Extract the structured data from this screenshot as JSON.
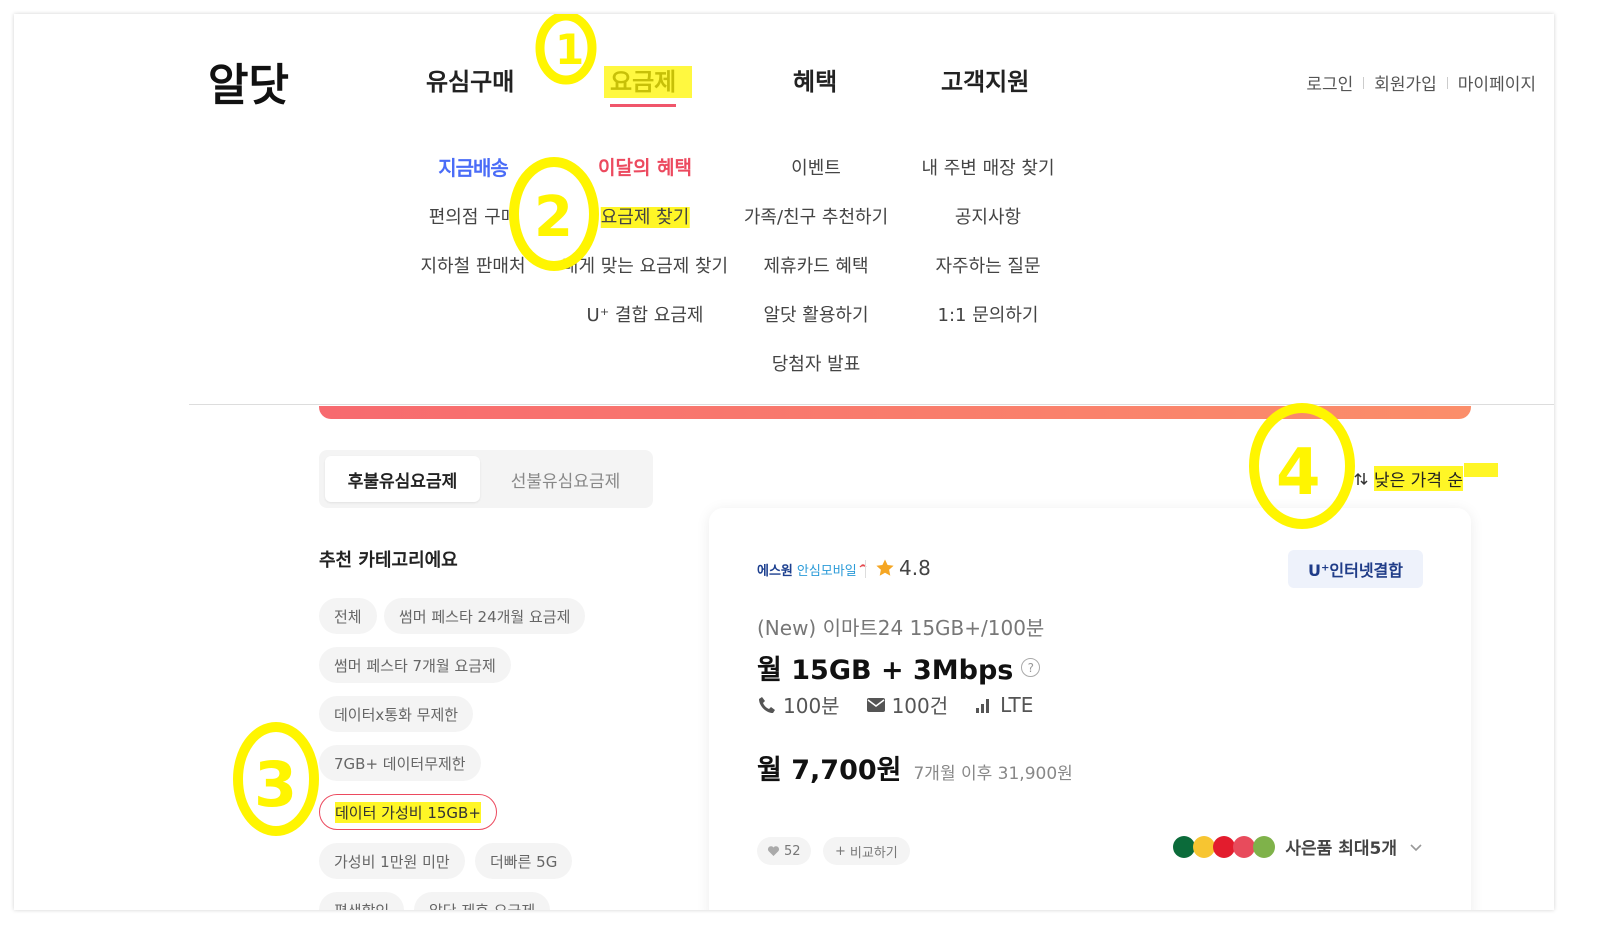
{
  "header": {
    "logo_text": "알닷",
    "nav": [
      "유심구매",
      "요금제",
      "혜택",
      "고객지원"
    ],
    "util": [
      "로그인",
      "회원가입",
      "마이페이지"
    ]
  },
  "submenu": {
    "col1": [
      "지금배송",
      "편의점 구매",
      "지하철 판매처"
    ],
    "col2": [
      "이달의 혜택",
      "요금제 찾기",
      "내게 맞는 요금제 찾기",
      "U⁺ 결합 요금제"
    ],
    "col3": [
      "이벤트",
      "가족/친구 추천하기",
      "제휴카드 혜택",
      "알닷 활용하기",
      "당첨자 발표"
    ],
    "col4": [
      "내 주변 매장 찾기",
      "공지사항",
      "자주하는 질문",
      "1:1 문의하기"
    ]
  },
  "tabs": {
    "active": "후불유심요금제",
    "inactive": "선불유심요금제"
  },
  "category": {
    "title": "추천 카테고리에요",
    "chips": [
      "전체",
      "썸머 페스타 24개월 요금제",
      "썸머 페스타 7개월 요금제",
      "데이터x통화 무제한",
      "7GB+ 데이터무제한",
      "데이터 가성비 15GB+",
      "가성비 1만원 미만",
      "더빠른 5G",
      "평생할인",
      "알닷 제휴 요금제"
    ]
  },
  "sort": {
    "label": "낮은 가격 순",
    "icon": "sort-arrows-icon"
  },
  "card": {
    "carrier_name": "에스원",
    "carrier_sub": "안심모바일",
    "rating": "4.8",
    "badge": "U⁺인터넷결합",
    "plan_name": "(New) 이마트24 15GB+/100분",
    "plan_data": "월 15GB + 3Mbps",
    "specs": {
      "call": "100분",
      "sms": "100건",
      "network": "LTE"
    },
    "price": "월 7,700원",
    "price_after": "7개월 이후 31,900원",
    "likes": "52",
    "compare": "비교하기",
    "gifts": "사은품 최대5개"
  },
  "annotations": [
    "1",
    "2",
    "3",
    "4"
  ],
  "colors": {
    "accent": "#ec4a5f",
    "brand_blue": "#4a6cf7",
    "highlight": "#fff500"
  }
}
